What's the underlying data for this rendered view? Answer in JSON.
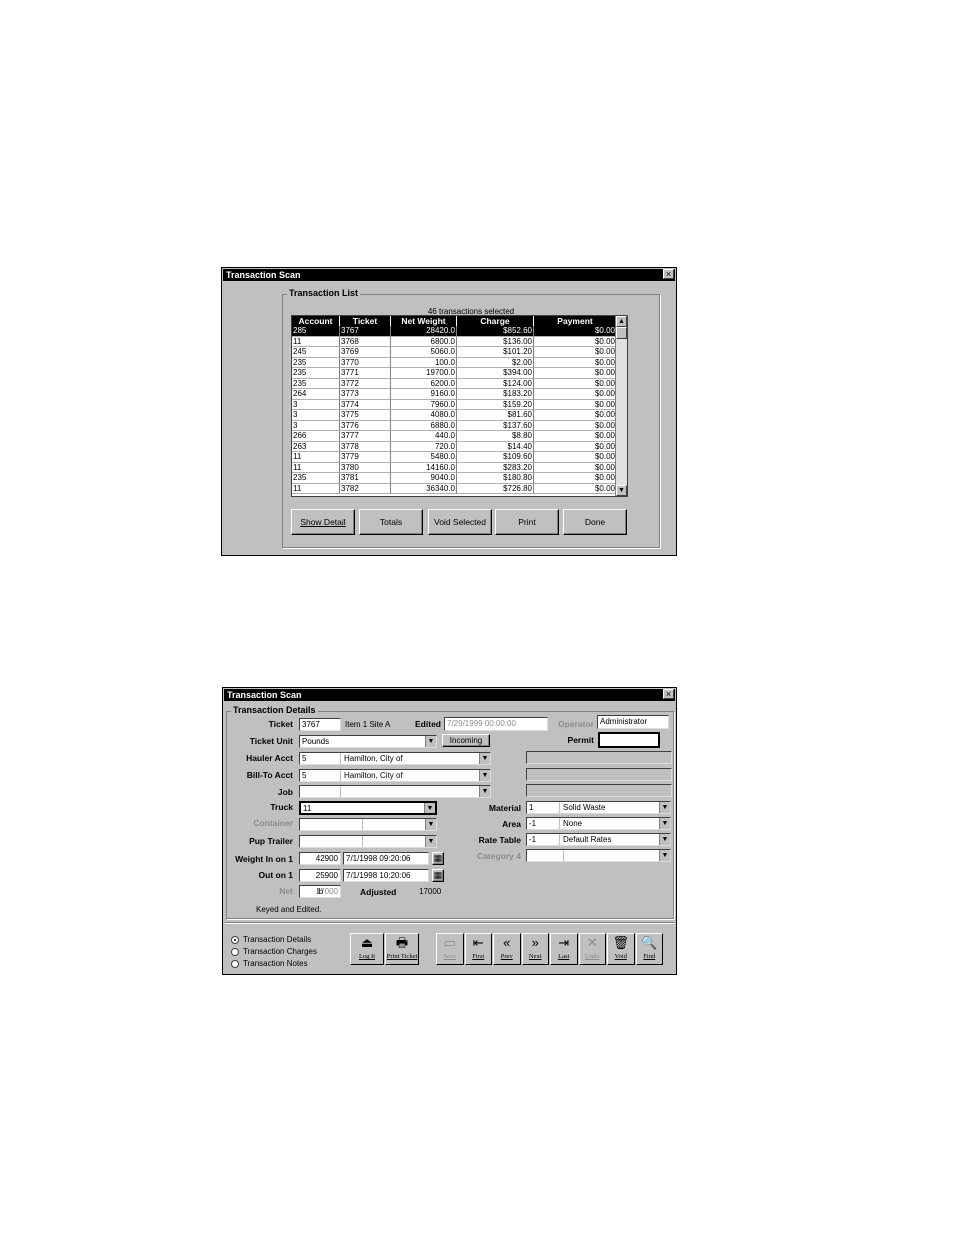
{
  "window1": {
    "title": "Transaction Scan",
    "group_label": "Transaction List",
    "count_text": "46 transactions selected",
    "columns": [
      "Account",
      "Ticket",
      "Net Weight",
      "Charge",
      "Payment"
    ],
    "rows": [
      [
        "285",
        "3767",
        "28420.0",
        "$852.60",
        "$0.00"
      ],
      [
        "11",
        "3768",
        "6800.0",
        "$136.00",
        "$0.00"
      ],
      [
        "245",
        "3769",
        "5060.0",
        "$101.20",
        "$0.00"
      ],
      [
        "235",
        "3770",
        "100.0",
        "$2.00",
        "$0.00"
      ],
      [
        "235",
        "3771",
        "19700.0",
        "$394.00",
        "$0.00"
      ],
      [
        "235",
        "3772",
        "6200.0",
        "$124.00",
        "$0.00"
      ],
      [
        "264",
        "3773",
        "9160.0",
        "$183.20",
        "$0.00"
      ],
      [
        "3",
        "3774",
        "7960.0",
        "$159.20",
        "$0.00"
      ],
      [
        "3",
        "3775",
        "4080.0",
        "$81.60",
        "$0.00"
      ],
      [
        "3",
        "3776",
        "6880.0",
        "$137.60",
        "$0.00"
      ],
      [
        "266",
        "3777",
        "440.0",
        "$8.80",
        "$0.00"
      ],
      [
        "263",
        "3778",
        "720.0",
        "$14.40",
        "$0.00"
      ],
      [
        "11",
        "3779",
        "5480.0",
        "$109.60",
        "$0.00"
      ],
      [
        "11",
        "3780",
        "14160.0",
        "$283.20",
        "$0.00"
      ],
      [
        "235",
        "3781",
        "9040.0",
        "$180.80",
        "$0.00"
      ],
      [
        "11",
        "3782",
        "36340.0",
        "$726.80",
        "$0.00"
      ]
    ],
    "buttons": [
      "Show Detail",
      "Totals",
      "Void Selected",
      "Print",
      "Done"
    ]
  },
  "window2": {
    "title": "Transaction Scan",
    "group_label": "Transaction Details",
    "ticket": {
      "label": "Ticket",
      "value": "3767",
      "item_text": "Item 1  Site A"
    },
    "edited": {
      "label": "Edited",
      "value": "7/29/1999 00:00:00"
    },
    "operator": {
      "label": "Operator",
      "value": "Administrator"
    },
    "ticket_unit": {
      "label": "Ticket Unit",
      "value": "Pounds",
      "button": "Incoming"
    },
    "permit": {
      "label": "Permit",
      "value": ""
    },
    "hauler_acct": {
      "label": "Hauler Acct",
      "code": "5",
      "name": "Hamilton, City of"
    },
    "bill_to_acct": {
      "label": "Bill-To Acct",
      "code": "5",
      "name": "Hamilton, City of"
    },
    "job": {
      "label": "Job"
    },
    "truck": {
      "label": "Truck",
      "value": "11"
    },
    "container": {
      "label": "Container"
    },
    "pup_trailer": {
      "label": "Pup Trailer"
    },
    "material": {
      "label": "Material",
      "code": "1",
      "name": "Solid Waste"
    },
    "area": {
      "label": "Area",
      "code": "-1",
      "name": "None"
    },
    "rate_table": {
      "label": "Rate Table",
      "code": "-1",
      "name": "Default Rates"
    },
    "category4": {
      "label": "Category 4"
    },
    "weight_in": {
      "label": "Weight In on 1",
      "value": "42900",
      "datetime": "7/1/1998 09:20:06"
    },
    "out_on": {
      "label": "Out on 1",
      "value": "25900",
      "datetime": "7/1/1998 10:20:06"
    },
    "net": {
      "label": "Net",
      "value": "17000",
      "unit": "lb",
      "adjusted_label": "Adjusted",
      "adjusted_value": "17000"
    },
    "status_text": "Keyed and Edited.",
    "radios": [
      "Transaction Details",
      "Transaction Charges",
      "Transaction Notes"
    ],
    "tool_left": [
      {
        "label": "Log It",
        "icon": "⏏"
      },
      {
        "label": "Print Ticket",
        "icon": "🖶"
      }
    ],
    "tool_right": [
      {
        "label": "Save",
        "icon": "▭",
        "disabled": true
      },
      {
        "label": "First",
        "icon": "⇤",
        "disabled": false
      },
      {
        "label": "Prev",
        "icon": "«",
        "disabled": false
      },
      {
        "label": "Next",
        "icon": "»",
        "disabled": false
      },
      {
        "label": "Last",
        "icon": "⇥",
        "disabled": false
      },
      {
        "label": "Undo",
        "icon": "✕",
        "disabled": true
      },
      {
        "label": "Void",
        "icon": "🗑",
        "disabled": false
      },
      {
        "label": "Find",
        "icon": "🔍",
        "disabled": false
      }
    ]
  }
}
